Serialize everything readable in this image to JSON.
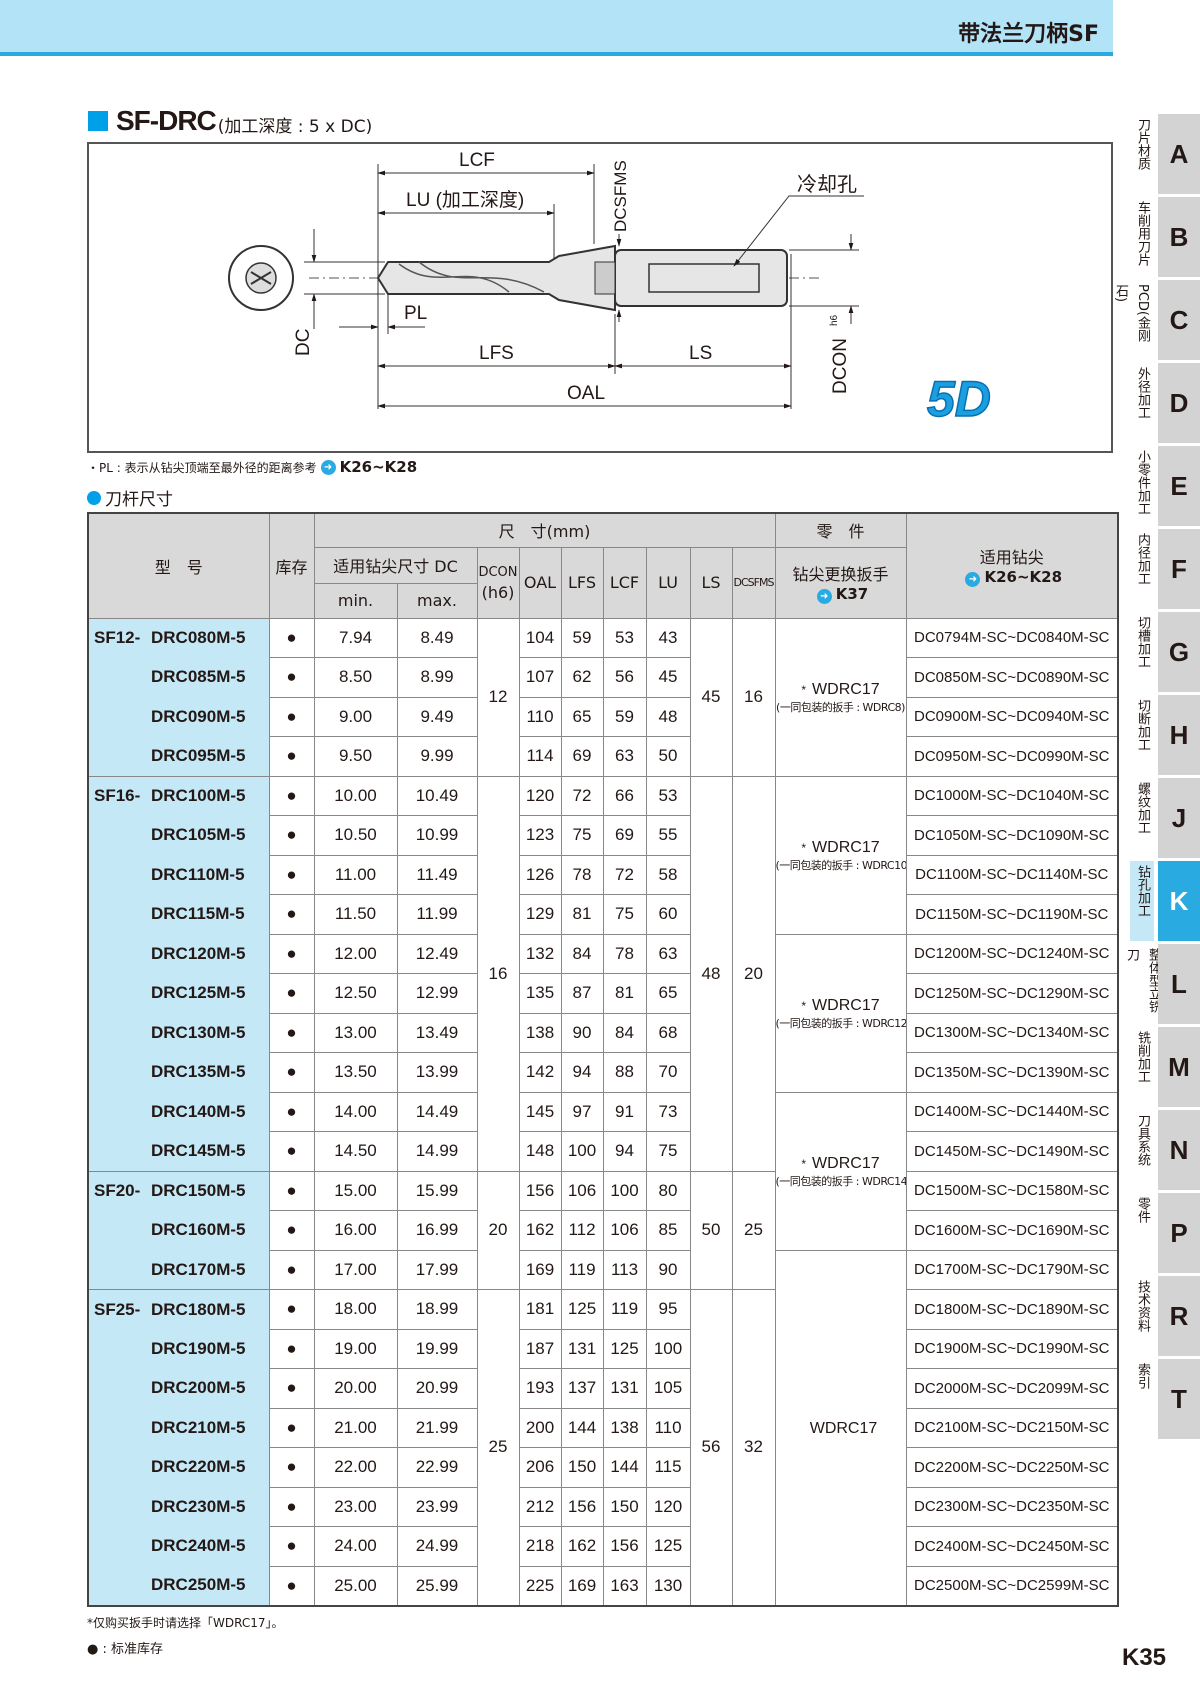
{
  "header": {
    "title": "带法兰刀柄SF"
  },
  "section": {
    "title": "SF-DRC",
    "subtitle": "(加工深度 : 5 x DC)"
  },
  "diagram": {
    "lcf": "LCF",
    "lu": "LU (加工深度)",
    "dcsfms": "DCSFMS",
    "coolant": "冷却孔",
    "dc": "DC",
    "pl": "PL",
    "lfs": "LFS",
    "ls": "LS",
    "oal": "OAL",
    "dcon": "DCON",
    "dcon_sup": "h6",
    "badge": "5D",
    "badge_color": "#1aa0e0"
  },
  "note": {
    "text": "・PL : 表示从钻尖顶端至最外径的距离参考",
    "ref": "K26~K28",
    "arrow_icon": "arrow-right-circle"
  },
  "table_title": "刀杆尺寸",
  "table": {
    "headers": {
      "model": "型　号",
      "stock": "库存",
      "dims": "尺　寸(mm)",
      "parts": "零　件",
      "dc": "适用钻尖尺寸 DC",
      "min": "min.",
      "max": "max.",
      "dcon": "DCON",
      "dcon2": "(h6)",
      "oal": "OAL",
      "lfs": "LFS",
      "lcf": "LCF",
      "lu": "LU",
      "ls": "LS",
      "dcsfms": "DCSFMS",
      "wrench": "钻尖更换扳手",
      "wrench_ref": "K37",
      "tip": "适用钻尖",
      "tip_ref": "K26~K28"
    },
    "rows": [
      {
        "prefix": "SF12-",
        "model": "DRC080M-5",
        "stock": "●",
        "min": "7.94",
        "max": "8.49",
        "oal": "104",
        "lfs": "59",
        "lcf": "53",
        "lu": "43",
        "tip": "DC0794M-SC~DC0840M-SC"
      },
      {
        "prefix": "",
        "model": "DRC085M-5",
        "stock": "●",
        "min": "8.50",
        "max": "8.99",
        "oal": "107",
        "lfs": "62",
        "lcf": "56",
        "lu": "45",
        "tip": "DC0850M-SC~DC0890M-SC"
      },
      {
        "prefix": "",
        "model": "DRC090M-5",
        "stock": "●",
        "min": "9.00",
        "max": "9.49",
        "oal": "110",
        "lfs": "65",
        "lcf": "59",
        "lu": "48",
        "tip": "DC0900M-SC~DC0940M-SC"
      },
      {
        "prefix": "",
        "model": "DRC095M-5",
        "stock": "●",
        "min": "9.50",
        "max": "9.99",
        "oal": "114",
        "lfs": "69",
        "lcf": "63",
        "lu": "50",
        "tip": "DC0950M-SC~DC0990M-SC"
      },
      {
        "prefix": "SF16-",
        "model": "DRC100M-5",
        "stock": "●",
        "min": "10.00",
        "max": "10.49",
        "oal": "120",
        "lfs": "72",
        "lcf": "66",
        "lu": "53",
        "tip": "DC1000M-SC~DC1040M-SC"
      },
      {
        "prefix": "",
        "model": "DRC105M-5",
        "stock": "●",
        "min": "10.50",
        "max": "10.99",
        "oal": "123",
        "lfs": "75",
        "lcf": "69",
        "lu": "55",
        "tip": "DC1050M-SC~DC1090M-SC"
      },
      {
        "prefix": "",
        "model": "DRC110M-5",
        "stock": "●",
        "min": "11.00",
        "max": "11.49",
        "oal": "126",
        "lfs": "78",
        "lcf": "72",
        "lu": "58",
        "tip": "DC1100M-SC~DC1140M-SC"
      },
      {
        "prefix": "",
        "model": "DRC115M-5",
        "stock": "●",
        "min": "11.50",
        "max": "11.99",
        "oal": "129",
        "lfs": "81",
        "lcf": "75",
        "lu": "60",
        "tip": "DC1150M-SC~DC1190M-SC"
      },
      {
        "prefix": "",
        "model": "DRC120M-5",
        "stock": "●",
        "min": "12.00",
        "max": "12.49",
        "oal": "132",
        "lfs": "84",
        "lcf": "78",
        "lu": "63",
        "tip": "DC1200M-SC~DC1240M-SC"
      },
      {
        "prefix": "",
        "model": "DRC125M-5",
        "stock": "●",
        "min": "12.50",
        "max": "12.99",
        "oal": "135",
        "lfs": "87",
        "lcf": "81",
        "lu": "65",
        "tip": "DC1250M-SC~DC1290M-SC"
      },
      {
        "prefix": "",
        "model": "DRC130M-5",
        "stock": "●",
        "min": "13.00",
        "max": "13.49",
        "oal": "138",
        "lfs": "90",
        "lcf": "84",
        "lu": "68",
        "tip": "DC1300M-SC~DC1340M-SC"
      },
      {
        "prefix": "",
        "model": "DRC135M-5",
        "stock": "●",
        "min": "13.50",
        "max": "13.99",
        "oal": "142",
        "lfs": "94",
        "lcf": "88",
        "lu": "70",
        "tip": "DC1350M-SC~DC1390M-SC"
      },
      {
        "prefix": "",
        "model": "DRC140M-5",
        "stock": "●",
        "min": "14.00",
        "max": "14.49",
        "oal": "145",
        "lfs": "97",
        "lcf": "91",
        "lu": "73",
        "tip": "DC1400M-SC~DC1440M-SC"
      },
      {
        "prefix": "",
        "model": "DRC145M-5",
        "stock": "●",
        "min": "14.50",
        "max": "14.99",
        "oal": "148",
        "lfs": "100",
        "lcf": "94",
        "lu": "75",
        "tip": "DC1450M-SC~DC1490M-SC"
      },
      {
        "prefix": "SF20-",
        "model": "DRC150M-5",
        "stock": "●",
        "min": "15.00",
        "max": "15.99",
        "oal": "156",
        "lfs": "106",
        "lcf": "100",
        "lu": "80",
        "tip": "DC1500M-SC~DC1580M-SC"
      },
      {
        "prefix": "",
        "model": "DRC160M-5",
        "stock": "●",
        "min": "16.00",
        "max": "16.99",
        "oal": "162",
        "lfs": "112",
        "lcf": "106",
        "lu": "85",
        "tip": "DC1600M-SC~DC1690M-SC"
      },
      {
        "prefix": "",
        "model": "DRC170M-5",
        "stock": "●",
        "min": "17.00",
        "max": "17.99",
        "oal": "169",
        "lfs": "119",
        "lcf": "113",
        "lu": "90",
        "tip": "DC1700M-SC~DC1790M-SC"
      },
      {
        "prefix": "SF25-",
        "model": "DRC180M-5",
        "stock": "●",
        "min": "18.00",
        "max": "18.99",
        "oal": "181",
        "lfs": "125",
        "lcf": "119",
        "lu": "95",
        "tip": "DC1800M-SC~DC1890M-SC"
      },
      {
        "prefix": "",
        "model": "DRC190M-5",
        "stock": "●",
        "min": "19.00",
        "max": "19.99",
        "oal": "187",
        "lfs": "131",
        "lcf": "125",
        "lu": "100",
        "tip": "DC1900M-SC~DC1990M-SC"
      },
      {
        "prefix": "",
        "model": "DRC200M-5",
        "stock": "●",
        "min": "20.00",
        "max": "20.99",
        "oal": "193",
        "lfs": "137",
        "lcf": "131",
        "lu": "105",
        "tip": "DC2000M-SC~DC2099M-SC"
      },
      {
        "prefix": "",
        "model": "DRC210M-5",
        "stock": "●",
        "min": "21.00",
        "max": "21.99",
        "oal": "200",
        "lfs": "144",
        "lcf": "138",
        "lu": "110",
        "tip": "DC2100M-SC~DC2150M-SC"
      },
      {
        "prefix": "",
        "model": "DRC220M-5",
        "stock": "●",
        "min": "22.00",
        "max": "22.99",
        "oal": "206",
        "lfs": "150",
        "lcf": "144",
        "lu": "115",
        "tip": "DC2200M-SC~DC2250M-SC"
      },
      {
        "prefix": "",
        "model": "DRC230M-5",
        "stock": "●",
        "min": "23.00",
        "max": "23.99",
        "oal": "212",
        "lfs": "156",
        "lcf": "150",
        "lu": "120",
        "tip": "DC2300M-SC~DC2350M-SC"
      },
      {
        "prefix": "",
        "model": "DRC240M-5",
        "stock": "●",
        "min": "24.00",
        "max": "24.99",
        "oal": "218",
        "lfs": "162",
        "lcf": "156",
        "lu": "125",
        "tip": "DC2400M-SC~DC2450M-SC"
      },
      {
        "prefix": "",
        "model": "DRC250M-5",
        "stock": "●",
        "min": "25.00",
        "max": "25.99",
        "oal": "225",
        "lfs": "169",
        "lcf": "163",
        "lu": "130",
        "tip": "DC2500M-SC~DC2599M-SC"
      }
    ],
    "shank_groups": [
      {
        "start": 0,
        "span": 4,
        "dcon": "12",
        "ls": "45",
        "dcsfms": "16"
      },
      {
        "start": 4,
        "span": 10,
        "dcon": "16",
        "ls": "48",
        "dcsfms": "20"
      },
      {
        "start": 14,
        "span": 3,
        "dcon": "20",
        "ls": "50",
        "dcsfms": "25"
      },
      {
        "start": 17,
        "span": 8,
        "dcon": "25",
        "ls": "56",
        "dcsfms": "32"
      }
    ],
    "wrench_groups": [
      {
        "start": 0,
        "span": 4,
        "mark": "*",
        "name": "WDRC17",
        "note": "(一同包装的扳手 : WDRC8)"
      },
      {
        "start": 4,
        "span": 4,
        "mark": "*",
        "name": "WDRC17",
        "note": "(一同包装的扳手 : WDRC10)"
      },
      {
        "start": 8,
        "span": 4,
        "mark": "*",
        "name": "WDRC17",
        "note": "(一同包装的扳手 : WDRC12)"
      },
      {
        "start": 12,
        "span": 4,
        "mark": "*",
        "name": "WDRC17",
        "note": "(一同包装的扳手 : WDRC14)"
      },
      {
        "start": 16,
        "span": 9,
        "mark": "",
        "name": "WDRC17",
        "note": ""
      }
    ]
  },
  "footer": {
    "note1": "*仅购买扳手时请选择「WDRC17」。",
    "note2": "● : 标准库存",
    "page": "K35"
  },
  "side_tabs": [
    {
      "letter": "A",
      "label": "刀片材质"
    },
    {
      "letter": "B",
      "label": "车削用刀片"
    },
    {
      "letter": "C",
      "label": "CBN PCD(金刚石)"
    },
    {
      "letter": "D",
      "label": "外径加工"
    },
    {
      "letter": "E",
      "label": "小零件加工"
    },
    {
      "letter": "F",
      "label": "内径加工"
    },
    {
      "letter": "G",
      "label": "切槽加工"
    },
    {
      "letter": "H",
      "label": "切断加工"
    },
    {
      "letter": "J",
      "label": "螺纹加工"
    },
    {
      "letter": "K",
      "label": "钻孔加工",
      "active": true
    },
    {
      "letter": "L",
      "label": "整体型立铣刀"
    },
    {
      "letter": "M",
      "label": "铣削加工"
    },
    {
      "letter": "N",
      "label": "刀具系统"
    },
    {
      "letter": "P",
      "label": "零件"
    },
    {
      "letter": "R",
      "label": "技术资料"
    },
    {
      "letter": "T",
      "label": "索引"
    }
  ],
  "colors": {
    "header_band": "#b3e3f7",
    "accent": "#29abe2",
    "model_col": "#c5e8f7",
    "table_header": "#d9d9d9"
  }
}
